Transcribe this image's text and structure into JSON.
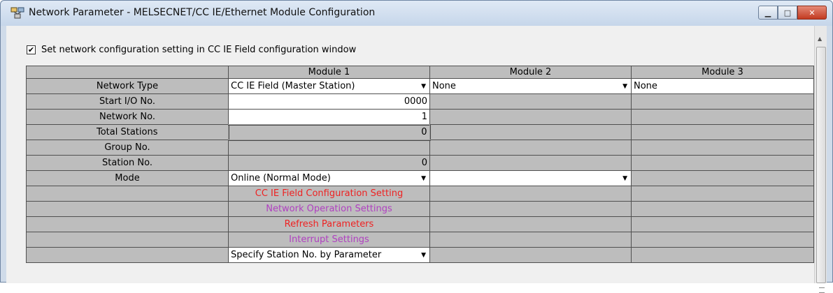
{
  "window": {
    "title": "Network Parameter - MELSECNET/CC IE/Ethernet Module Configuration",
    "buttons": {
      "minimize": "▁",
      "maximize": "□",
      "close": "✕"
    }
  },
  "config": {
    "checkbox_label": "Set network configuration setting in CC IE Field configuration window",
    "checkbox_checked": "✔"
  },
  "table": {
    "columns": [
      "",
      "Module 1",
      "Module 2",
      "Module 3"
    ],
    "rows": {
      "network_type": {
        "label": "Network Type",
        "m1": "CC IE Field (Master Station)",
        "m2": "None",
        "m3": "None"
      },
      "start_io": {
        "label": "Start I/O No.",
        "m1": "0000"
      },
      "network_no": {
        "label": "Network No.",
        "m1": "1"
      },
      "total_stations": {
        "label": "Total Stations",
        "m1": "0"
      },
      "group_no": {
        "label": "Group No."
      },
      "station_no": {
        "label": "Station No.",
        "m1": "0"
      },
      "mode": {
        "label": "Mode",
        "m1": "Online (Normal Mode)"
      },
      "cc_ie_config": {
        "m1": "CC IE Field Configuration Setting"
      },
      "net_op": {
        "m1": "Network Operation Settings"
      },
      "refresh": {
        "m1": "Refresh Parameters"
      },
      "interrupt": {
        "m1": "Interrupt Settings"
      },
      "specify_station": {
        "m1": "Specify Station No. by Parameter"
      }
    }
  },
  "colors": {
    "red_link": "#ee2222",
    "purple_link": "#b040c0",
    "cell_grey": "#bdbdbd"
  }
}
